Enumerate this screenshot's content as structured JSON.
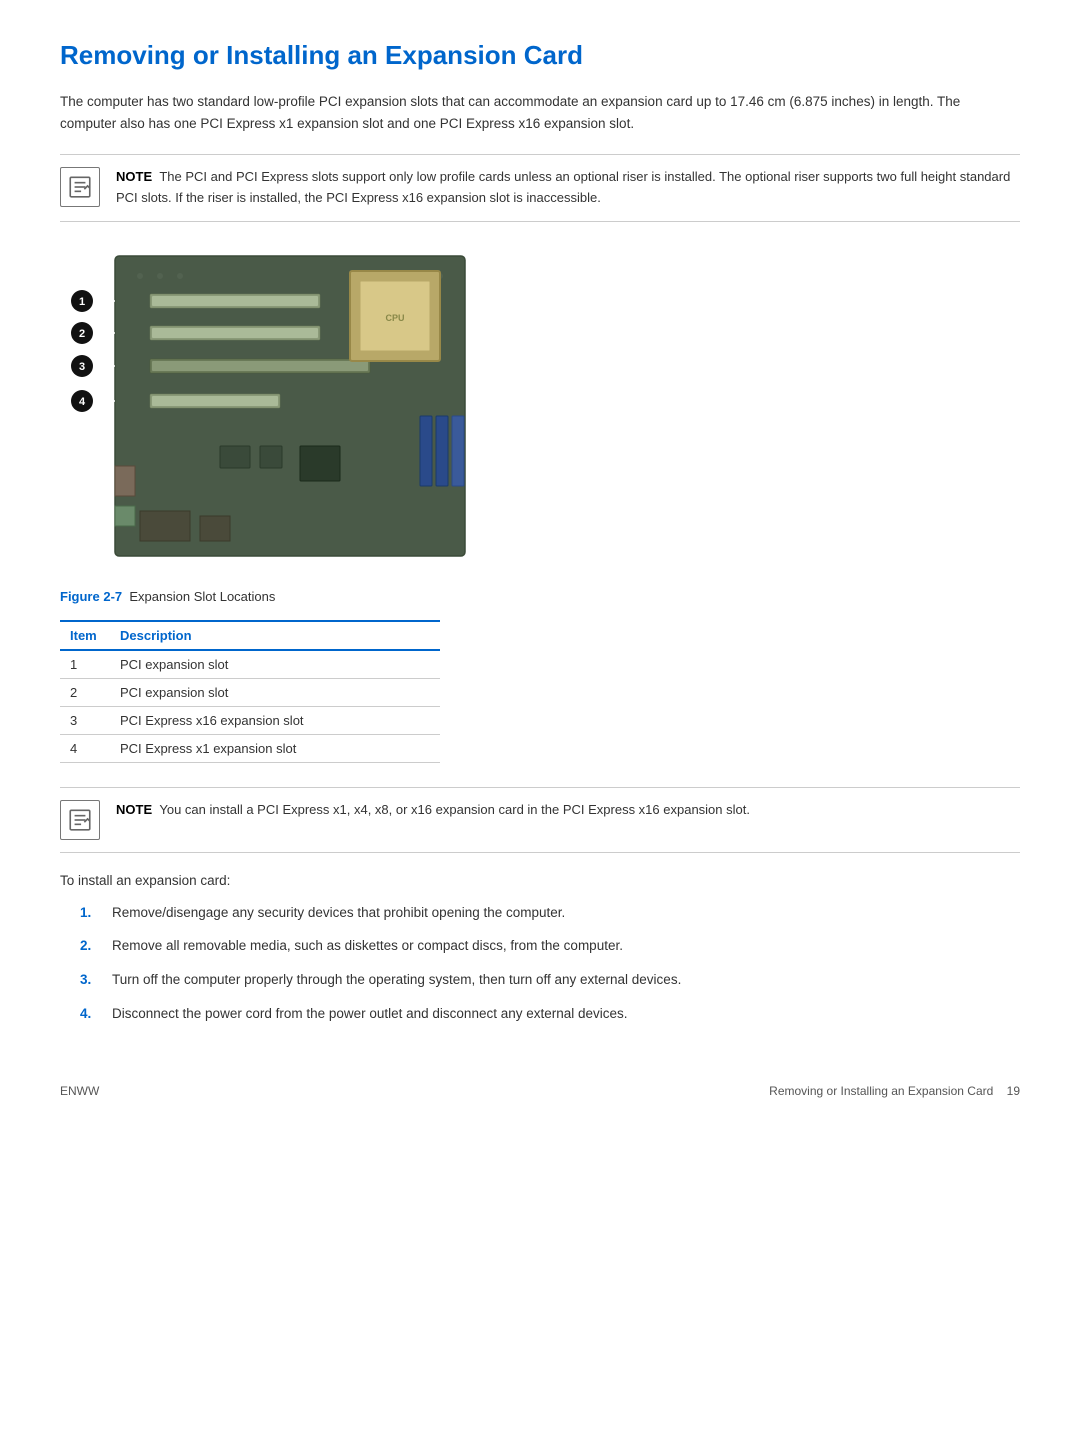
{
  "page": {
    "title": "Removing or Installing an Expansion Card",
    "footer_left": "ENWW",
    "footer_right": "Removing or Installing an Expansion Card",
    "footer_page": "19"
  },
  "intro": {
    "text": "The computer has two standard low-profile PCI expansion slots that can accommodate an expansion card up to 17.46 cm (6.875 inches) in length. The computer also has one PCI Express x1 expansion slot and one PCI Express x16 expansion slot."
  },
  "note1": {
    "label": "NOTE",
    "text": "The PCI and PCI Express slots support only low profile cards unless an optional riser is installed. The optional riser supports two full height standard PCI slots. If the riser is installed, the PCI Express x16 expansion slot is inaccessible."
  },
  "figure": {
    "number": "2-7",
    "caption": "Expansion Slot Locations",
    "callouts": [
      "1",
      "2",
      "3",
      "4"
    ]
  },
  "table": {
    "header_item": "Item",
    "header_description": "Description",
    "rows": [
      {
        "item": "1",
        "description": "PCI expansion slot"
      },
      {
        "item": "2",
        "description": "PCI expansion slot"
      },
      {
        "item": "3",
        "description": "PCI Express x16 expansion slot"
      },
      {
        "item": "4",
        "description": "PCI Express x1 expansion slot"
      }
    ]
  },
  "note2": {
    "label": "NOTE",
    "text": "You can install a PCI Express x1, x4, x8, or x16 expansion card in the PCI Express x16 expansion slot."
  },
  "install_intro": "To install an expansion card:",
  "steps": [
    "Remove/disengage any security devices that prohibit opening the computer.",
    "Remove all removable media, such as diskettes or compact discs, from the computer.",
    "Turn off the computer properly through the operating system, then turn off any external devices.",
    "Disconnect the power cord from the power outlet and disconnect any external devices."
  ]
}
